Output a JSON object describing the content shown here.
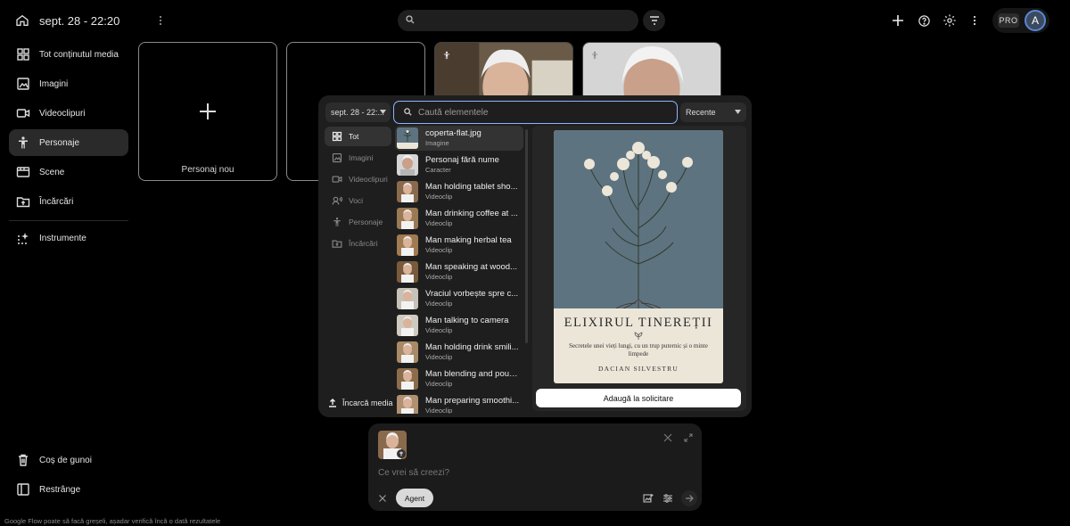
{
  "header": {
    "date_title": "sept. 28 - 22:20",
    "search_placeholder": "",
    "pro_label": "PRO",
    "avatar_initial": "A"
  },
  "sidebar": {
    "items": [
      {
        "label": "Tot conținutul media",
        "icon": "grid-icon"
      },
      {
        "label": "Imagini",
        "icon": "image-icon"
      },
      {
        "label": "Videoclipuri",
        "icon": "video-icon"
      },
      {
        "label": "Personaje",
        "icon": "person-icon"
      },
      {
        "label": "Scene",
        "icon": "scene-icon"
      },
      {
        "label": "Încărcări",
        "icon": "upload-folder-icon"
      },
      {
        "label": "Instrumente",
        "icon": "sparkle-icon"
      }
    ],
    "active": "Personaje",
    "bottom": [
      {
        "label": "Coș de gunoi",
        "icon": "trash-icon"
      },
      {
        "label": "Restrânge",
        "icon": "collapse-icon"
      }
    ]
  },
  "cards": {
    "new_character_label": "Personaj nou"
  },
  "picker": {
    "date_filter": "sept. 28 - 22:...",
    "search_placeholder": "Caută elementele",
    "sort": "Recente",
    "categories": [
      {
        "label": "Tot",
        "icon": "grid-icon",
        "active": true
      },
      {
        "label": "Imagini",
        "icon": "image-icon",
        "active": false
      },
      {
        "label": "Videoclipuri",
        "icon": "video-icon",
        "active": false
      },
      {
        "label": "Voci",
        "icon": "voice-icon",
        "active": false
      },
      {
        "label": "Personaje",
        "icon": "person-icon",
        "active": false
      },
      {
        "label": "Încărcări",
        "icon": "upload-folder-icon",
        "active": false
      }
    ],
    "upload_label": "Încarcă media",
    "items": [
      {
        "name": "coperta-flat.jpg",
        "type": "Imagine",
        "thumb": "book"
      },
      {
        "name": "Personaj fără nume",
        "type": "Caracter",
        "thumb": "face"
      },
      {
        "name": "Man holding tablet sho...",
        "type": "Videoclip",
        "thumb": "man"
      },
      {
        "name": "Man drinking coffee at ...",
        "type": "Videoclip",
        "thumb": "man"
      },
      {
        "name": "Man making herbal tea",
        "type": "Videoclip",
        "thumb": "man"
      },
      {
        "name": "Man speaking at wood...",
        "type": "Videoclip",
        "thumb": "man"
      },
      {
        "name": "Vraciul vorbește spre c...",
        "type": "Videoclip",
        "thumb": "man"
      },
      {
        "name": "Man talking to camera",
        "type": "Videoclip",
        "thumb": "man"
      },
      {
        "name": "Man holding drink smili...",
        "type": "Videoclip",
        "thumb": "man"
      },
      {
        "name": "Man blending and pouri...",
        "type": "Videoclip",
        "thumb": "man"
      },
      {
        "name": "Man preparing smoothi...",
        "type": "Videoclip",
        "thumb": "man"
      }
    ],
    "preview": {
      "title": "ELIXIRUL TINEREȚII",
      "subtitle": "Secretele unei vieți lungi, cu un trup puternic și o minte limpede",
      "author": "DACIAN SILVESTRU"
    },
    "add_button": "Adaugă la solicitare"
  },
  "prompt": {
    "placeholder": "Ce vrei să creezi?",
    "agent_label": "Agent"
  },
  "footer": {
    "disclaimer": "Google Flow poate să facă greșeli, așadar verifică încă o dată rezultatele"
  },
  "colors": {
    "background": "#000000",
    "panel": "#1e1e1e",
    "accent_focus": "#8fb3ff",
    "avatar_ring": "#5a86d6"
  }
}
